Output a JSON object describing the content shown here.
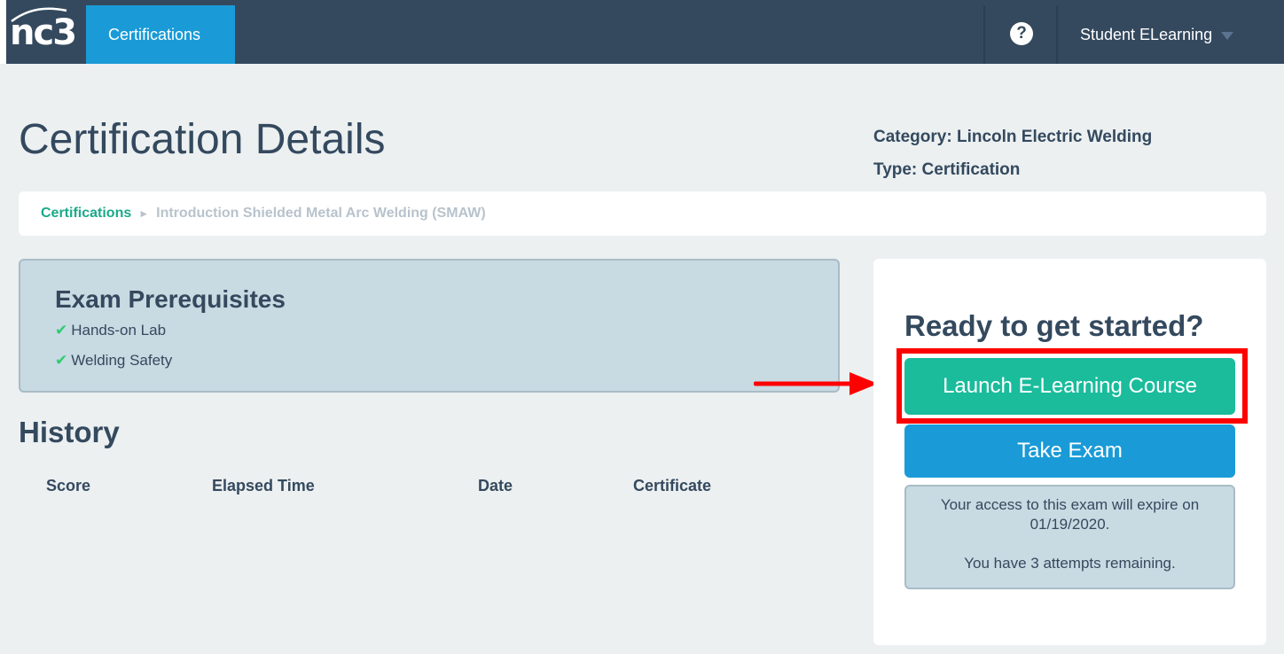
{
  "navbar": {
    "logo_text": "nc3",
    "tab_certifications": "Certifications",
    "help_icon": "?",
    "user_name": "Student ELearning"
  },
  "header": {
    "title": "Certification Details",
    "category": "Category: Lincoln Electric Welding",
    "type": "Type: Certification"
  },
  "breadcrumb": {
    "root": "Certifications",
    "separator": "►",
    "current": "Introduction Shielded Metal Arc Welding (SMAW)"
  },
  "prerequisites": {
    "title": "Exam Prerequisites",
    "check_glyph": "✔",
    "items": [
      "Hands-on Lab",
      "Welding Safety"
    ]
  },
  "history": {
    "title": "History",
    "columns": [
      "Score",
      "Elapsed Time",
      "Date",
      "Certificate"
    ]
  },
  "panel": {
    "heading": "Ready to get started?",
    "launch_label": "Launch E-Learning Course",
    "exam_label": "Take Exam",
    "notice_line1": "Your access to this exam will expire on",
    "notice_line2": "01/19/2020.",
    "notice_line3": "You have 3 attempts remaining."
  },
  "colors": {
    "navbar": "#34495e",
    "active_tab": "#1a9bd7",
    "launch_button": "#1abc9c",
    "exam_button": "#1a9bd7",
    "highlight": "#ff0000",
    "check": "#2ecc71"
  }
}
